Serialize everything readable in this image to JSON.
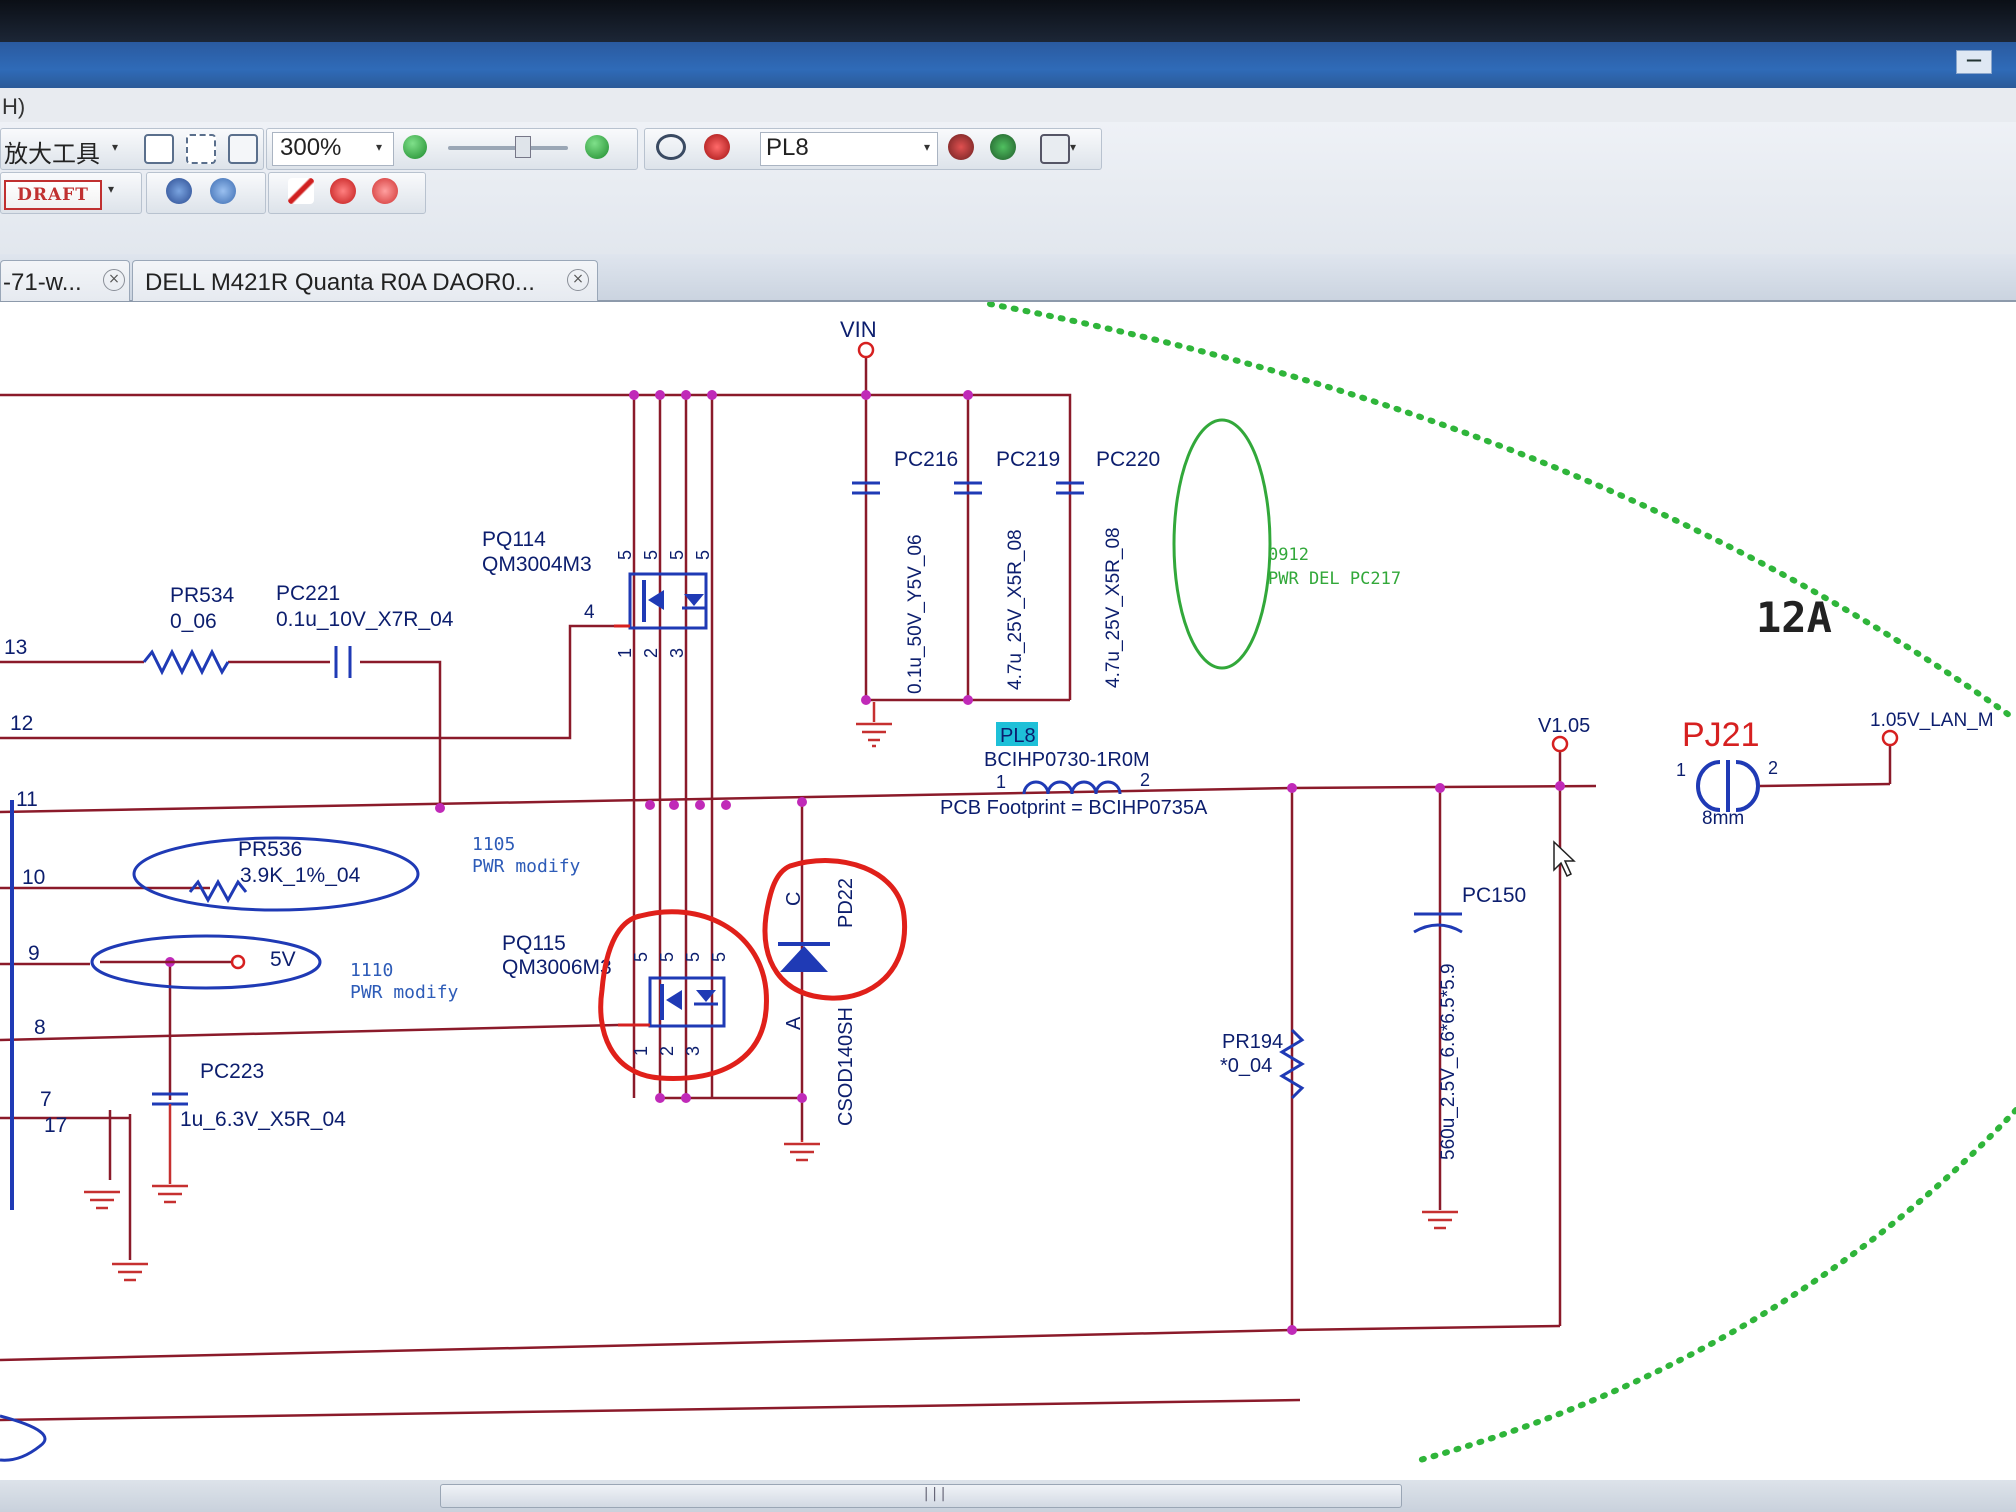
{
  "window": {
    "menu_fragment": "H)",
    "minimize_glyph": "—"
  },
  "toolbar": {
    "magnifier_tools_label": "放大工具",
    "zoom_value": "300%",
    "net_selector_value": "PL8",
    "draft_label": "DRAFT",
    "dropdown_glyph": "▾"
  },
  "tabs": [
    {
      "label": "-71-w...",
      "close_glyph": "×"
    },
    {
      "label": "DELL M421R Quanta R0A DAOR0...",
      "close_glyph": "×"
    }
  ],
  "schematic": {
    "vin_label": "VIN",
    "pin_numbers_left": [
      "13",
      "12",
      "11",
      "10",
      "9",
      "8",
      "7",
      "17"
    ],
    "pr534": {
      "ref": "PR534",
      "value": "0_06"
    },
    "pc221": {
      "ref": "PC221",
      "value": "0.1u_10V_X7R_04"
    },
    "pq114": {
      "ref": "PQ114",
      "part": "QM3004M3",
      "gate_pin": "4",
      "drain_pins": [
        "5",
        "5",
        "5",
        "5"
      ],
      "source_pins": [
        "1",
        "2",
        "3"
      ]
    },
    "pq115": {
      "ref": "PQ115",
      "part": "QM3006M3",
      "drain_pins": [
        "5",
        "5",
        "5",
        "5"
      ],
      "source_pins": [
        "1",
        "2",
        "3"
      ]
    },
    "pc216": {
      "ref": "PC216",
      "value": "0.1u_50V_Y5V_06"
    },
    "pc219": {
      "ref": "PC219",
      "value": "4.7u_25V_X5R_08"
    },
    "pc220": {
      "ref": "PC220",
      "value": "4.7u_25V_X5R_08"
    },
    "note_0912": {
      "line1": "0912",
      "line2": "PWR DEL PC217"
    },
    "current_label": "12A",
    "pl8": {
      "ref": "PL8",
      "part": "BCIHP0730-1R0M",
      "footprint": "PCB Footprint = BCIHP0735A",
      "pin1": "1",
      "pin2": "2"
    },
    "v105_label": "V1.05",
    "pj21": {
      "ref": "PJ21",
      "size": "8mm",
      "pin1": "1",
      "pin2": "2"
    },
    "lan_label": "1.05V_LAN_M",
    "pr536": {
      "ref": "PR536",
      "value": "3.9K_1%_04"
    },
    "note_1105": {
      "line1": "1105",
      "line2": "PWR modify"
    },
    "note_1110": {
      "line1": "1110",
      "line2": "PWR modify"
    },
    "rail_5v_label": "5V",
    "pd22": {
      "ref": "PD22",
      "part": "CSOD140SH",
      "cathode": "C",
      "anode": "A"
    },
    "pc150": {
      "ref": "PC150",
      "value": "560u_2.5V_6.6*6.5*5.9"
    },
    "pr194": {
      "ref": "PR194",
      "value": "*0_04"
    },
    "pc223": {
      "ref": "PC223",
      "value": "1u_6.3V_X5R_04"
    },
    "colors": {
      "wire": "#8b1a2a",
      "text": "#0c1e6e",
      "comment": "#2e5cb8",
      "note_green": "#32a83a",
      "markup_red": "#e0201a",
      "highlight": "#1ec0d8",
      "junction": "#c02ab8"
    }
  },
  "scrollbar": {
    "grip": "|||"
  }
}
